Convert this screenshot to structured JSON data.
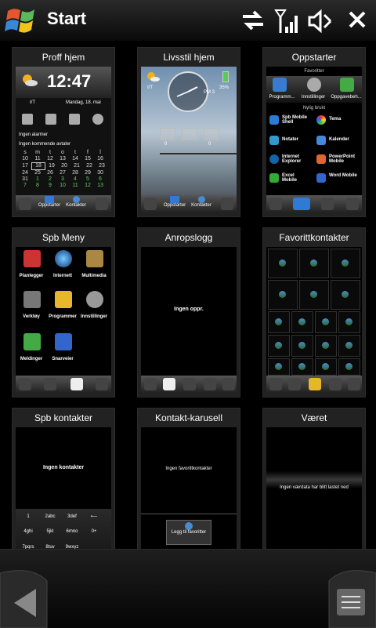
{
  "header": {
    "title": "Start"
  },
  "tiles": [
    {
      "title": "Proff hjem",
      "clock": "12:47",
      "day_label": "I/T",
      "date": "Mandag, 18. mai",
      "alarm": "Ingen alarmer",
      "appointments": "Ingen kommende avtaler",
      "calendar": {
        "days": [
          "s",
          "m",
          "t",
          "o",
          "t",
          "f",
          "l"
        ],
        "rows": [
          [
            "10",
            "11",
            "12",
            "13",
            "14",
            "15",
            "16"
          ],
          [
            "17",
            "18",
            "19",
            "20",
            "21",
            "22",
            "23"
          ],
          [
            "24",
            "25",
            "26",
            "27",
            "28",
            "29",
            "30"
          ],
          [
            "31",
            "1",
            "2",
            "3",
            "4",
            "5",
            "6"
          ],
          [
            "7",
            "8",
            "9",
            "10",
            "11",
            "12",
            "13"
          ]
        ]
      },
      "bar": [
        "Oppstarter",
        "Kontakter"
      ]
    },
    {
      "title": "Livsstil hjem",
      "day_label": "I/T",
      "temp_label": "PM 3",
      "battery": "35%",
      "left_count": "0",
      "right_count": "0",
      "bar": [
        "Oppstarter",
        "Kontakter"
      ]
    },
    {
      "title": "Oppstarter",
      "favorites_header": "Favoritter",
      "favorites": [
        "Programm...",
        "Innstillinger",
        "Oppgavebeh..."
      ],
      "recent_header": "Nylig brukt",
      "recent": [
        "Spb Mobile Shell",
        "Tema",
        "Notater",
        "Kalender",
        "Internet Explorer",
        "PowerPoint Mobile",
        "Excel Mobile",
        "Word Mobile"
      ]
    },
    {
      "title": "Spb Meny",
      "items": [
        "Planlegger",
        "Internett",
        "Multimedia",
        "Verktøy",
        "Programmer",
        "Innstillinger",
        "Meldinger",
        "Snarveier"
      ]
    },
    {
      "title": "Anropslogg",
      "empty": "Ingen oppr."
    },
    {
      "title": "Favorittkontakter"
    },
    {
      "title": "Spb kontakter",
      "empty": "Ingen kontakter",
      "keys": [
        [
          "1",
          "2abc",
          "3def",
          "⟵"
        ],
        [
          "4ghi",
          "5jkl",
          "6mno",
          "0+"
        ],
        [
          "7pqrs",
          "8tuv",
          "9wxyz",
          ""
        ]
      ]
    },
    {
      "title": "Kontakt-karusell",
      "empty": "Ingen favorittkontakter",
      "add_label": "Legg til favoritter"
    },
    {
      "title": "Været",
      "empty": "Ingen værdata har blitt lastet ned"
    }
  ],
  "colors": {
    "accent": "#2e7bd6"
  }
}
